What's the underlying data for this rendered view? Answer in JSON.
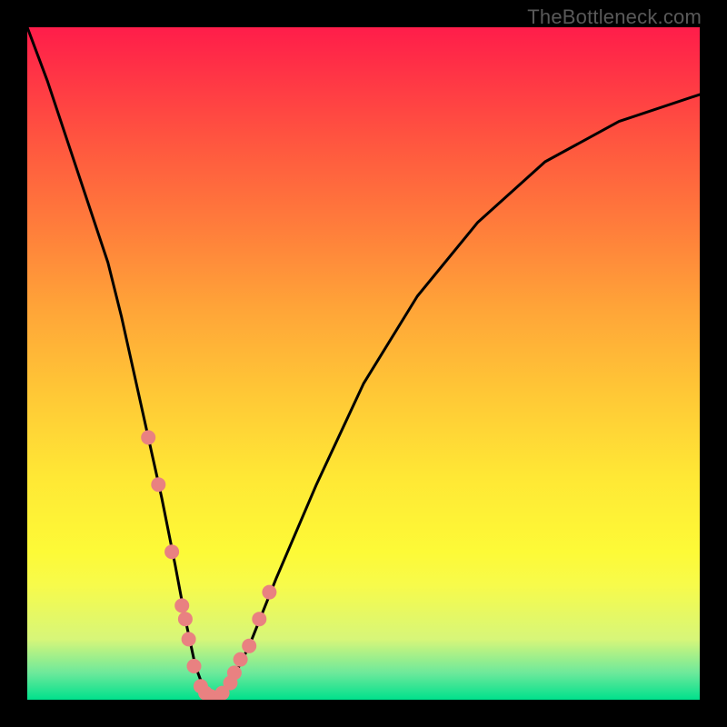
{
  "watermark": "TheBottleneck.com",
  "chart_data": {
    "type": "line",
    "title": "",
    "xlabel": "",
    "ylabel": "",
    "xlim": [
      0,
      100
    ],
    "ylim": [
      0,
      100
    ],
    "series": [
      {
        "name": "bottleneck-curve",
        "x": [
          0,
          3,
          6,
          9,
          12,
          14,
          16,
          18,
          20,
          22,
          23.5,
          25,
          26.5,
          28,
          30,
          33,
          37,
          43,
          50,
          58,
          67,
          77,
          88,
          100
        ],
        "values": [
          100,
          92,
          83,
          74,
          65,
          57,
          48,
          39,
          30,
          20,
          12,
          5,
          1,
          0,
          2,
          8,
          18,
          32,
          47,
          60,
          71,
          80,
          86,
          90
        ]
      }
    ],
    "markers": {
      "name": "highlighted-points",
      "color": "#e98181",
      "x": [
        18,
        19.5,
        21.5,
        23,
        23.5,
        24,
        24.8,
        25.8,
        26.5,
        27.3,
        28,
        29,
        30.2,
        30.8,
        31.7,
        33,
        34.5,
        36
      ],
      "values": [
        39,
        32,
        22,
        14,
        12,
        9,
        5,
        2,
        1,
        0.5,
        0,
        1,
        2.5,
        4,
        6,
        8,
        12,
        16
      ]
    },
    "gradient_background": {
      "top": "#ff1d4a",
      "upper_mid": "#ff7e3b",
      "mid": "#ffe835",
      "lower_mid": "#d7f679",
      "bottom": "#00e08c"
    }
  }
}
